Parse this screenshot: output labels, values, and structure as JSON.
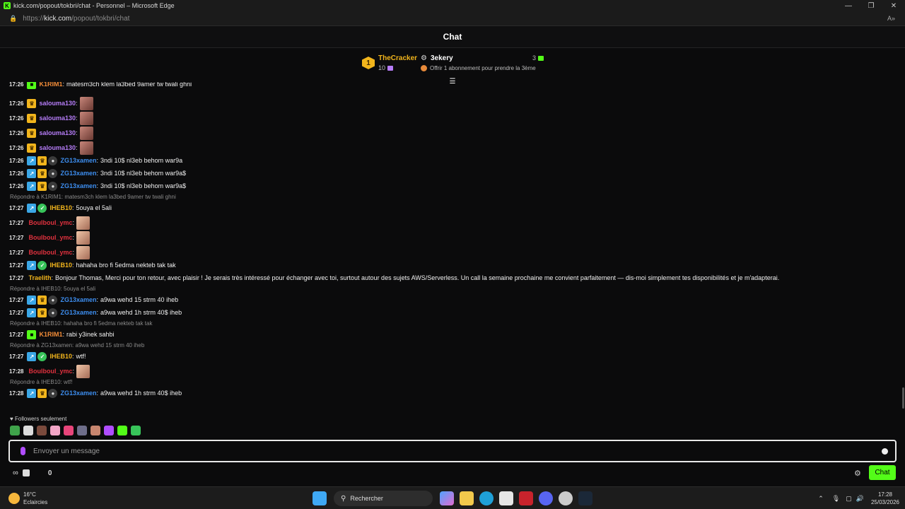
{
  "window": {
    "title": "kick.com/popout/tokbri/chat - Personnel – Microsoft Edge",
    "url_prefix": "https://",
    "url_host": "kick.com",
    "url_path": "/popout/tokbri/chat",
    "read_aloud": "A»"
  },
  "header": {
    "title": "Chat"
  },
  "leaderboard": {
    "rank": "1",
    "first_name": "TheCracker",
    "first_count": "10",
    "second_name": "3ekery",
    "second_count": "3",
    "offer_text": "Offrir 1 abonnement pour prendre la 3ème"
  },
  "messages": [
    {
      "time": "17:26",
      "user": "K1RIM1",
      "color": "#f28c38",
      "text": "matesm3ch klem la3bed 9amer tw twali ghni",
      "emote": false,
      "badges": [
        "green"
      ]
    },
    {
      "time": "17:26",
      "user": "salouma130",
      "color": "#b57cf7",
      "text": "",
      "emote": true,
      "badges": [
        "crown"
      ]
    },
    {
      "time": "17:26",
      "user": "salouma130",
      "color": "#b57cf7",
      "text": "",
      "emote": true,
      "badges": [
        "crown"
      ]
    },
    {
      "time": "17:26",
      "user": "salouma130",
      "color": "#b57cf7",
      "text": "",
      "emote": true,
      "badges": [
        "crown"
      ]
    },
    {
      "time": "17:26",
      "user": "salouma130",
      "color": "#b57cf7",
      "text": "",
      "emote": true,
      "badges": [
        "crown"
      ]
    },
    {
      "time": "17:26",
      "user": "ZG13xamen",
      "color": "#3d8ef0",
      "text": "3ndi 10$ nl3eb behom war9a",
      "emote": false,
      "badges": [
        "og",
        "crown",
        "sub"
      ]
    },
    {
      "time": "17:26",
      "user": "ZG13xamen",
      "color": "#3d8ef0",
      "text": "3ndi 10$ nl3eb behom war9a$",
      "emote": false,
      "badges": [
        "og",
        "crown",
        "sub"
      ]
    },
    {
      "time": "17:26",
      "user": "ZG13xamen",
      "color": "#3d8ef0",
      "text": "3ndi 10$ nl3eb behom war9a$",
      "emote": false,
      "badges": [
        "og",
        "crown",
        "sub"
      ]
    },
    {
      "time": "17:27",
      "user": "IHEB10",
      "color": "#f2b51c",
      "text": "5ouya el 5ali",
      "emote": false,
      "badges": [
        "og",
        "verified"
      ],
      "reply": "Répondre à K1RIM1: matesm3ch klem la3bed 9amer tw twali ghni"
    },
    {
      "time": "17:27",
      "user": "Boulboul_ymc",
      "color": "#e0313e",
      "text": "",
      "emote": true,
      "badges": []
    },
    {
      "time": "17:27",
      "user": "Boulboul_ymc",
      "color": "#e0313e",
      "text": "",
      "emote": true,
      "badges": []
    },
    {
      "time": "17:27",
      "user": "Boulboul_ymc",
      "color": "#e0313e",
      "text": "",
      "emote": true,
      "badges": []
    },
    {
      "time": "17:27",
      "user": "IHEB10",
      "color": "#f2b51c",
      "text": "hahaha bro fi 5edma nekteb tak tak",
      "emote": false,
      "badges": [
        "og",
        "verified"
      ]
    },
    {
      "time": "17:27",
      "user": "Traelith",
      "color": "#f2b51c",
      "text": "Bonjour Thomas, Merci pour ton retour, avec plaisir ! Je serais très intéressé pour échanger avec toi, surtout autour des sujets AWS/Serverless. Un call la semaine prochaine me convient parfaitement — dis-moi simplement tes disponibilités et je m'adapterai.",
      "emote": false,
      "badges": []
    },
    {
      "time": "17:27",
      "user": "ZG13xamen",
      "color": "#3d8ef0",
      "text": "a9wa wehd 15 strm 40 iheb",
      "emote": false,
      "badges": [
        "og",
        "crown",
        "sub"
      ],
      "reply": "Répondre à IHEB10: 5ouya el 5ali"
    },
    {
      "time": "17:27",
      "user": "ZG13xamen",
      "color": "#3d8ef0",
      "text": "a9wa wehd 1h strm 40$ iheb",
      "emote": false,
      "badges": [
        "og",
        "crown",
        "sub"
      ]
    },
    {
      "time": "17:27",
      "user": "K1RIM1",
      "color": "#f28c38",
      "text": "rabi y3inek sahbi",
      "emote": false,
      "badges": [
        "green"
      ],
      "reply": "Répondre à IHEB10: hahaha bro fi 5edma nekteb tak tak"
    },
    {
      "time": "17:27",
      "user": "IHEB10",
      "color": "#f2b51c",
      "text": "wtf!",
      "emote": false,
      "badges": [
        "og",
        "verified"
      ],
      "reply": "Répondre à ZG13xamen: a9wa wehd 15 strm 40 iheb"
    },
    {
      "time": "17:28",
      "user": "Boulboul_ymc",
      "color": "#e0313e",
      "text": "",
      "emote": true,
      "badges": []
    },
    {
      "time": "17:28",
      "user": "ZG13xamen",
      "color": "#3d8ef0",
      "text": "a9wa wehd 1h strm 40$ iheb",
      "emote": false,
      "badges": [
        "og",
        "crown",
        "sub"
      ],
      "reply": "Répondre à IHEB10: wtf!"
    }
  ],
  "chat_mode": "Followers seulement",
  "input": {
    "placeholder": "Envoyer un message"
  },
  "bottom": {
    "points": "0",
    "chat_button": "Chat",
    "infinity": "∞"
  },
  "taskbar": {
    "temp": "16°C",
    "weather": "Eclaircies",
    "search": "Rechercher",
    "time": "17:28",
    "date": "25/03/2026"
  },
  "colors": {
    "accent": "#53fc18"
  }
}
